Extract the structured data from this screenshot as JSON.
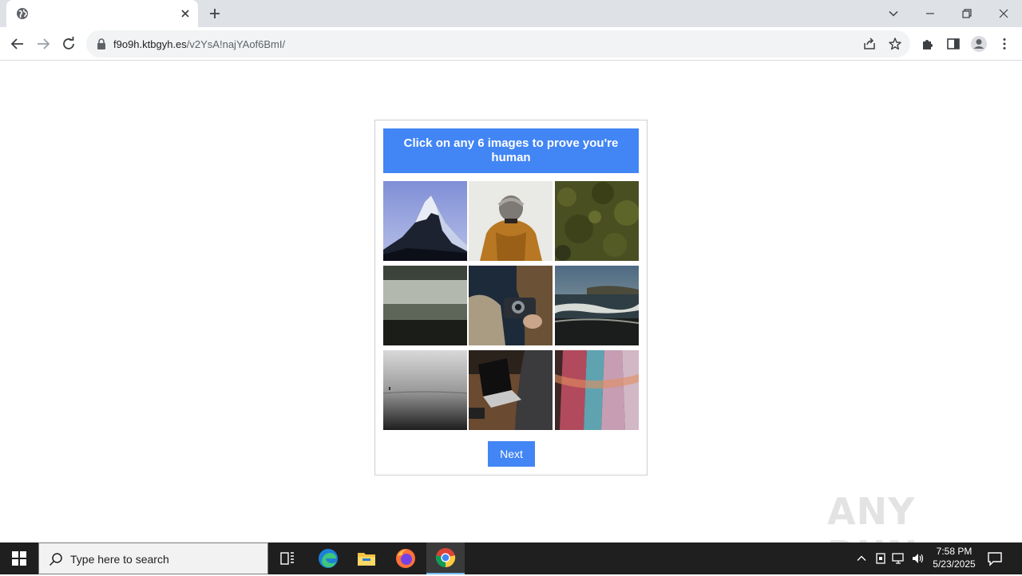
{
  "browser": {
    "tab": {
      "title": "",
      "favicon": "globe-icon"
    },
    "url": {
      "host": "f9o9h.ktbgyh.es",
      "path": "/v2YsA!najYAof6BmI/"
    }
  },
  "captcha": {
    "instruction": "Click on any 6 images to prove you're human",
    "tiles": [
      "mountain-peak",
      "person-beanie",
      "moss-texture",
      "foggy-field",
      "hands-camera",
      "ocean-waves",
      "misty-lake",
      "laptop-desk",
      "colorful-scarf"
    ],
    "next_label": "Next",
    "accent_color": "#4285f4"
  },
  "watermark": {
    "text": "ANY RUN"
  },
  "taskbar": {
    "search_placeholder": "Type here to search",
    "apps": [
      "task-view",
      "edge",
      "file-explorer",
      "firefox",
      "chrome"
    ],
    "active_app": "chrome",
    "clock": {
      "time": "7:58 PM",
      "date": "5/23/2025"
    }
  }
}
